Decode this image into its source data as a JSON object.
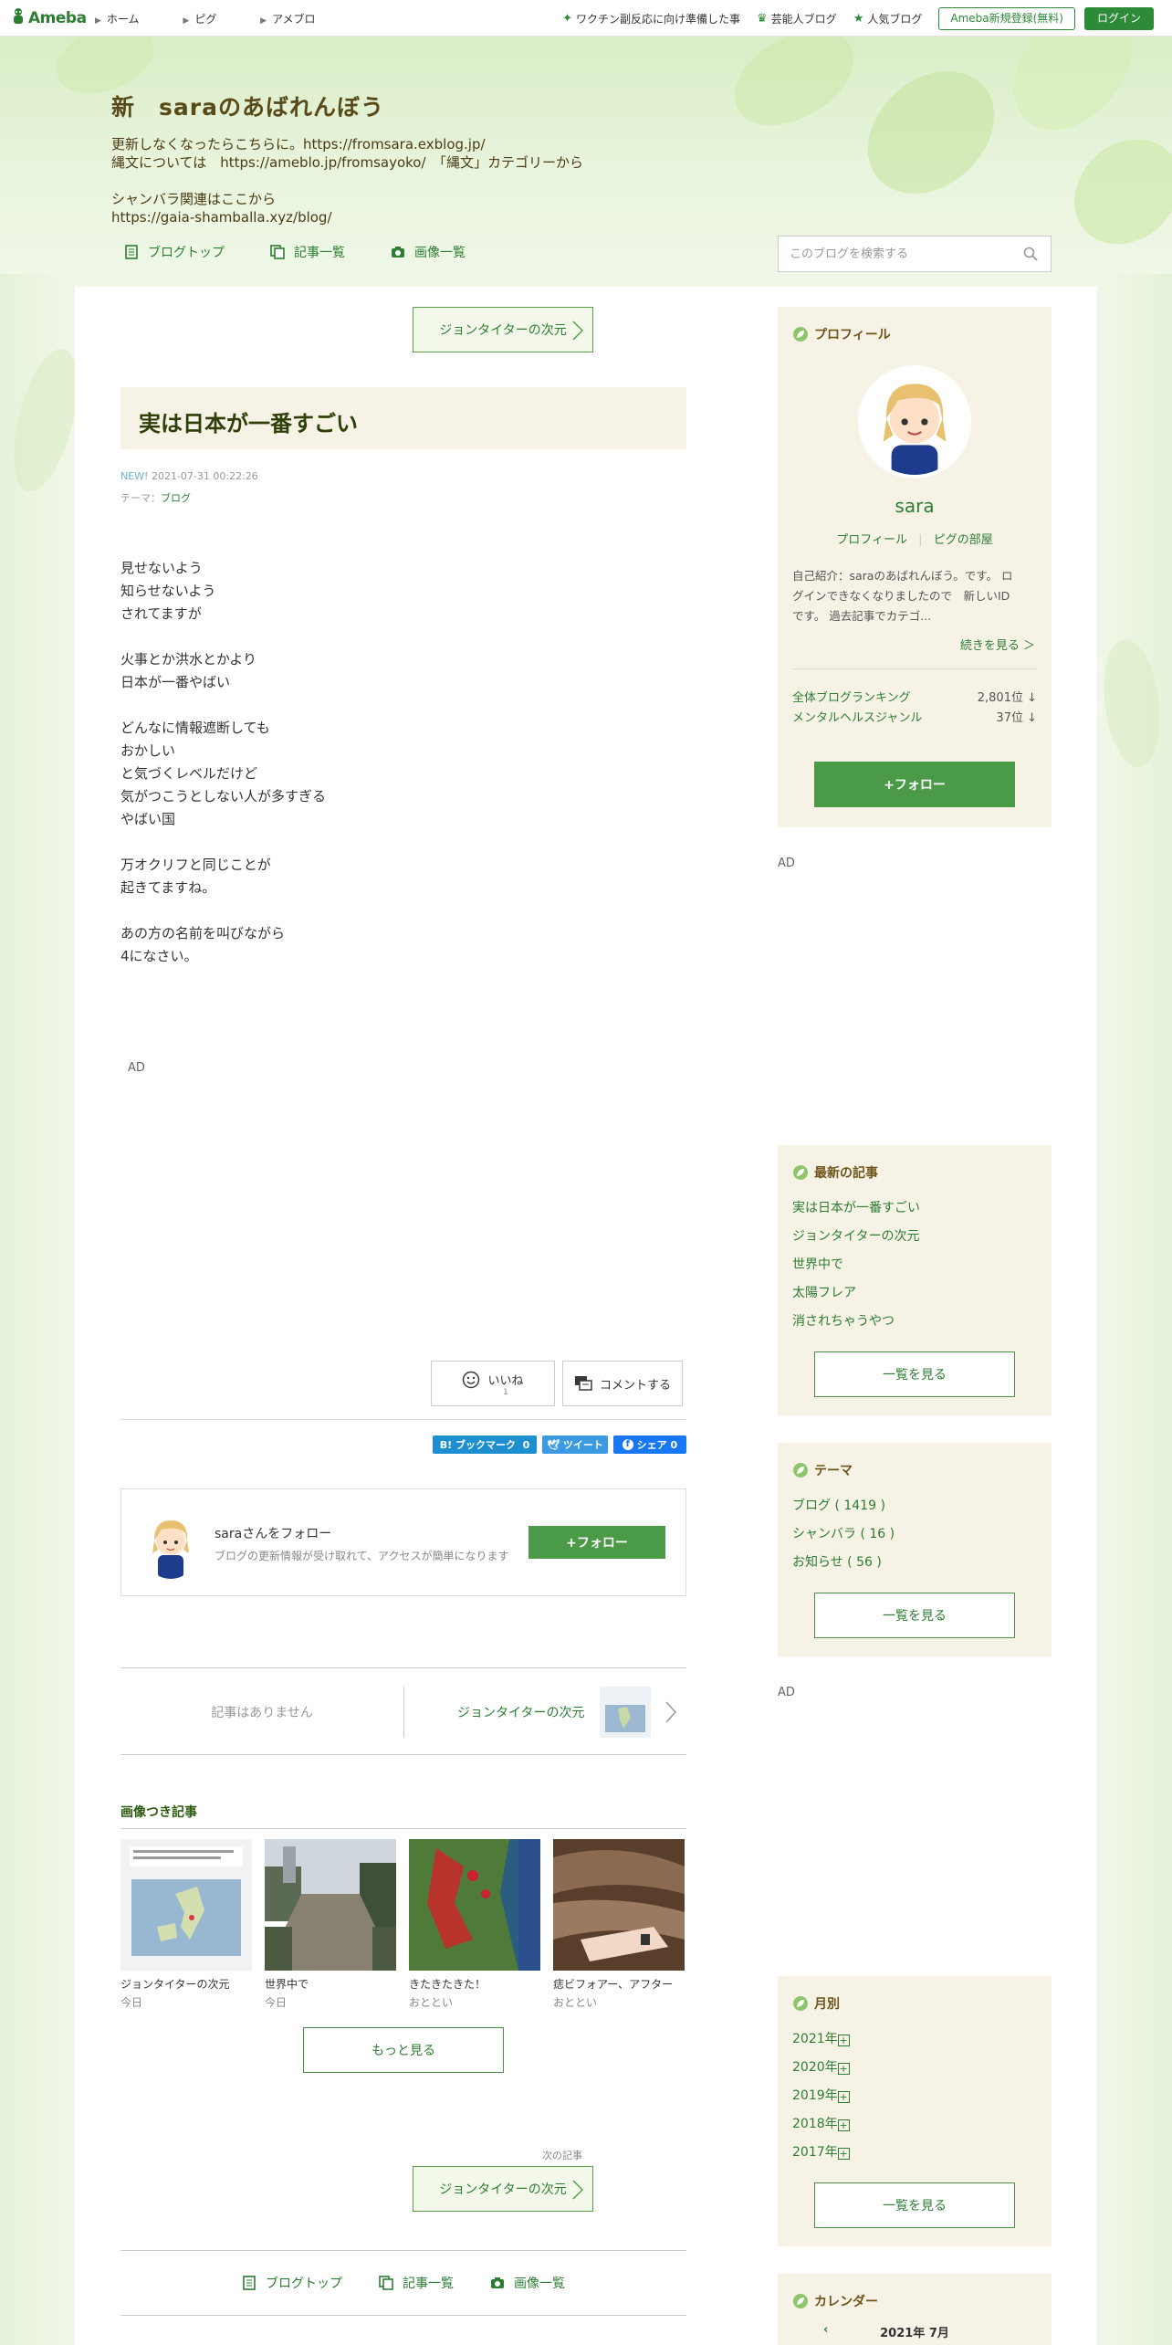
{
  "topbar": {
    "logo": "Ameba",
    "nav": [
      "ホーム",
      "ピグ",
      "アメブロ"
    ],
    "links": [
      "ワクチン副反応に向け準備した事",
      "芸能人ブログ",
      "人気ブログ"
    ],
    "register": "Ameba新規登録(無料)",
    "login": "ログイン"
  },
  "blog": {
    "title": "新　saraのあばれんぼう",
    "desc": [
      "更新しなくなったらこちらに。https://fromsara.exblog.jp/",
      "縄文については　https://ameblo.jp/fromsayoko/　「縄文」カテゴリーから",
      "",
      "シャンバラ関連はここから",
      "https://gaia-shamballa.xyz/blog/"
    ],
    "nav": [
      "ブログトップ",
      "記事一覧",
      "画像一覧"
    ],
    "search_placeholder": "このブログを検索する"
  },
  "article": {
    "prev_label": "ジョンタイターの次元",
    "title": "実は日本が一番すごい",
    "new": "NEW!",
    "date": "2021-07-31 00:22:26",
    "theme_label": "テーマ：",
    "theme": "ブログ",
    "body": [
      "見せないよう",
      "知らせないよう",
      "されてますが",
      "",
      "火事とか洪水とかより",
      "日本が一番やばい",
      "",
      "どんなに情報遮断しても",
      "おかしい",
      "と気づくレベルだけど",
      "気がつこうとしない人が多すぎる",
      "やばい国",
      "",
      "万オクリフと同じことが",
      "起きてますね。",
      "",
      "あの方の名前を叫びながら",
      "4になさい。"
    ],
    "ad": "AD",
    "like": "いいね",
    "like_count": "1",
    "comment": "コメントする",
    "share": {
      "hatena": "B! ブックマーク",
      "hatena_count": "0",
      "tweet": "ツイート",
      "fb": "シェア",
      "fb_count": "0"
    },
    "follow_name": "saraさんをフォロー",
    "follow_desc": "ブログの更新情報が受け取れて、アクセスが簡単になります",
    "follow_btn": "+フォロー",
    "pager_none": "記事はありません",
    "pager_next": "ジョンタイターの次元",
    "image_section": "画像つき記事",
    "thumbs": [
      {
        "cap": "ジョンタイターの次元",
        "date": "今日"
      },
      {
        "cap": "世界中で",
        "date": "今日"
      },
      {
        "cap": "きたきたきた！",
        "date": "おととい"
      },
      {
        "cap": "痣ビフォアー、アフター",
        "date": "おととい"
      }
    ],
    "more": "もっと見る",
    "next_small": "次の記事",
    "next_label": "ジョンタイターの次元"
  },
  "sidebar": {
    "profile_title": "プロフィール",
    "name": "sara",
    "profile_link": "プロフィール",
    "pig_link": "ピグの部屋",
    "intro": [
      "自己紹介：saraのあばれんぼう。です。 ロ",
      "グインできなくなりましたので　新しいID",
      "です。 過去記事でカテゴ..."
    ],
    "more": "続きを見る ＞",
    "rank1_label": "全体ブログランキング",
    "rank1_val": "2,801位 ↓",
    "rank2_label": "メンタルヘルスジャンル",
    "rank2_val": "37位 ↓",
    "follow": "+フォロー",
    "ad": "AD",
    "latest_title": "最新の記事",
    "latest": [
      "実は日本が一番すごい",
      "ジョンタイターの次元",
      "世界中で",
      "太陽フレア",
      "消されちゃうやつ"
    ],
    "see_all": "一覧を見る",
    "theme_title": "テーマ",
    "themes": [
      "ブログ ( 1419 )",
      "シャンバラ ( 16 )",
      "お知らせ ( 56 )"
    ],
    "month_title": "月別",
    "months": [
      "2021年",
      "2020年",
      "2019年",
      "2018年",
      "2017年"
    ],
    "calendar_title": "カレンダー",
    "calendar_month": "2021年 7月"
  },
  "colors": {
    "accent": "#2d8a38",
    "follow": "#4b9a48",
    "box": "#f6f2e6"
  }
}
